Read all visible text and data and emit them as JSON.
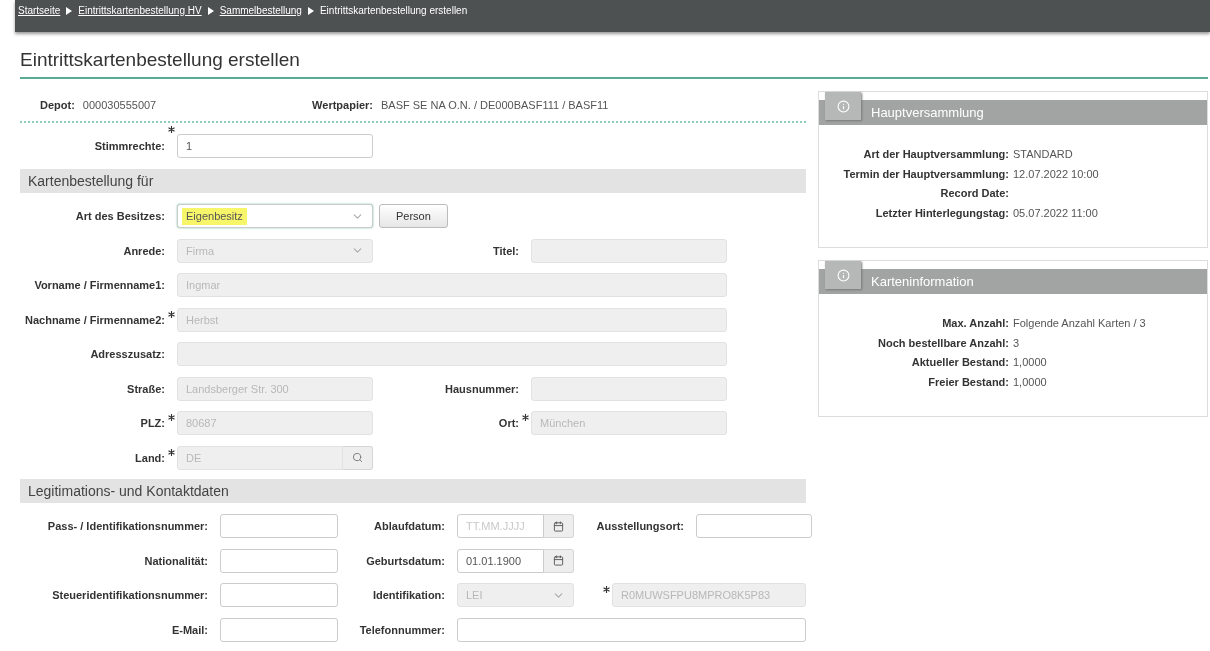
{
  "breadcrumb": [
    {
      "label": "Startseite",
      "current": false
    },
    {
      "label": "Eintrittskartenbestellung HV",
      "current": false
    },
    {
      "label": "Sammelbestellung",
      "current": false
    },
    {
      "label": "Eintrittskartenbestellung erstellen",
      "current": true
    }
  ],
  "title": "Eintrittskartenbestellung erstellen",
  "summary": [
    {
      "label": "Depot:",
      "value": "000030555007"
    },
    {
      "label": "Wertpapier:",
      "value": "BASF SE NA O.N. / DE000BASF111 / BASF11"
    }
  ],
  "voting": {
    "label": "Stimmrechte:",
    "required": true,
    "value": "1"
  },
  "order_section": {
    "title": "Kartenbestellung für",
    "rows": [
      [
        {
          "kind": "select",
          "label": "Art des Besitzes:",
          "required": false,
          "value": "Eigenbesitz",
          "disabled": false,
          "highlighted": true
        },
        {
          "kind": "button",
          "label": "Person"
        }
      ],
      [
        {
          "kind": "select",
          "label": "Anrede:",
          "required": false,
          "value": "Firma",
          "disabled": true,
          "highlighted": false
        },
        {
          "kind": "text",
          "label": "Titel:",
          "required": false,
          "disabled": true
        }
      ],
      [
        {
          "kind": "text",
          "label": "Vorname / Firmenname1:",
          "required": false,
          "value": "Ingmar",
          "disabled": true
        }
      ],
      [
        {
          "kind": "text",
          "label": "Nachname / Firmenname2:",
          "required": true,
          "value": "Herbst",
          "disabled": true
        }
      ],
      [
        {
          "kind": "text",
          "label": "Adresszusatz:",
          "required": false,
          "disabled": true
        }
      ],
      [
        {
          "kind": "text",
          "label": "Straße:",
          "required": false,
          "value": "Landsberger Str. 300",
          "disabled": true
        },
        {
          "kind": "text",
          "label": "Hausnummer:",
          "required": false,
          "disabled": true
        }
      ],
      [
        {
          "kind": "text",
          "label": "PLZ:",
          "required": true,
          "value": "80687",
          "disabled": true
        },
        {
          "kind": "text",
          "label": "Ort:",
          "required": true,
          "value": "München",
          "disabled": true
        }
      ],
      [
        {
          "kind": "lookup",
          "label": "Land:",
          "required": true,
          "value": "DE",
          "disabled": true
        }
      ]
    ]
  },
  "legit_section": {
    "title": "Legitimations- und Kontaktdaten",
    "rows": [
      [
        {
          "kind": "text",
          "label": "Pass- / Identifikationsnummer:",
          "required": false,
          "disabled": false
        },
        {
          "kind": "date",
          "label": "Ablaufdatum:",
          "required": false,
          "placeholder": "TT.MM.JJJJ",
          "disabled": false
        },
        {
          "kind": "text",
          "label": "Ausstellungsort:",
          "required": false,
          "disabled": false
        }
      ],
      [
        {
          "kind": "text",
          "label": "Nationalität:",
          "required": false,
          "disabled": false
        },
        {
          "kind": "date",
          "label": "Geburtsdatum:",
          "required": false,
          "value": "01.01.1900",
          "disabled": false
        }
      ],
      [
        {
          "kind": "text",
          "label": "Steueridentifikationsnummer:",
          "required": false,
          "disabled": false
        },
        {
          "kind": "select",
          "label": "Identifikation:",
          "required": false,
          "value": "LEI",
          "disabled": true,
          "highlighted": false
        },
        {
          "kind": "text",
          "required": true,
          "value": "R0MUWSFPU8MPRO8K5P83",
          "disabled": true
        }
      ],
      [
        {
          "kind": "text",
          "label": "E-Mail:",
          "required": false,
          "disabled": false
        },
        {
          "kind": "text",
          "label": "Telefonnummer:",
          "required": false,
          "disabled": false
        }
      ]
    ]
  },
  "panels": [
    {
      "title": "Hauptversammlung",
      "rows": [
        {
          "label": "Art der Hauptversammlung:",
          "value": "STANDARD"
        },
        {
          "label": "Termin der Hauptversammlung:",
          "value": "12.07.2022 10:00"
        },
        {
          "label": "Record Date:"
        },
        {
          "label": "Letzter Hinterlegungstag:",
          "value": "05.07.2022 11:00"
        }
      ]
    },
    {
      "title": "Karteninformation",
      "rows": [
        {
          "label": "Max. Anzahl:",
          "value": "Folgende Anzahl Karten / 3"
        },
        {
          "label": "Noch bestellbare Anzahl:",
          "value": "3"
        },
        {
          "label": "Aktueller Bestand:",
          "value": "1,0000"
        },
        {
          "label": "Freier Bestand:",
          "value": "1,0000"
        }
      ]
    }
  ]
}
